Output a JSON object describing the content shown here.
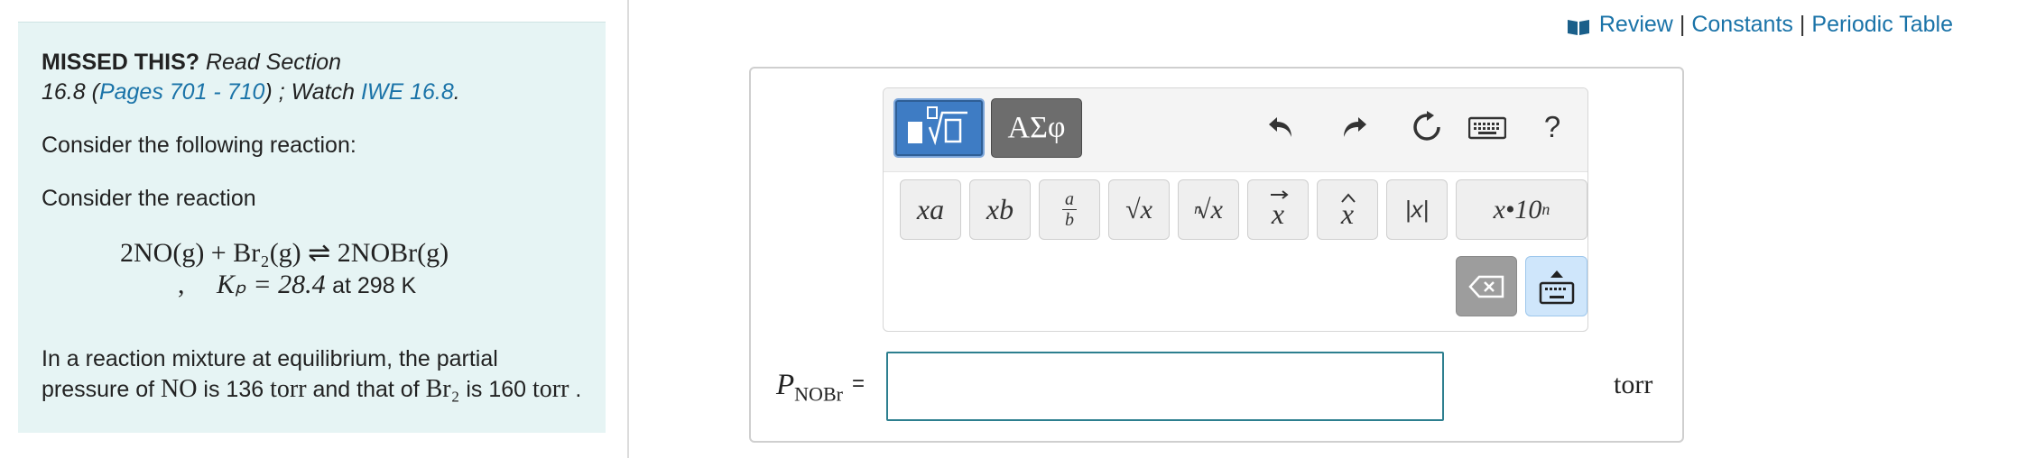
{
  "left_panel": {
    "missed_bold": "MISSED THIS?",
    "read_section": "Read Section",
    "section_num": "16.8 (",
    "pages_link": "Pages 701 - 710",
    "watch_prefix": ") ; Watch",
    "iwe_link": "IWE 16.8",
    "period": ".",
    "consider_following": "Consider the following reaction:",
    "consider_reaction": "Consider the reaction",
    "equation": "2NO(g) + Br₂(g) ⇌ 2NOBr(g)",
    "comma": ",",
    "kp_expr": "Kₚ = 28.4",
    "kp_at": "at 298 K",
    "mixture_part1": "In a reaction mixture at equilibrium, the partial pressure of",
    "no_species": "NO",
    "mixture_part2": "is 136",
    "torr1": "torr",
    "mixture_part3": "and that of",
    "br2_species": "Br₂",
    "mixture_part4": "is 160",
    "torr2": "torr",
    "mixture_end": "."
  },
  "nav": {
    "review": "Review",
    "separator": "|",
    "constants": "Constants",
    "periodic_table": "Periodic Table"
  },
  "toolbar": {
    "greek_label": "ΑΣφ",
    "help_label": "?",
    "keys": {
      "superscript_base": "x",
      "superscript_exp": "a",
      "subscript_base": "x",
      "subscript_sub": "b",
      "fraction_num": "a",
      "fraction_den": "b",
      "sqrt_label": "√x",
      "nthroot_index": "n",
      "nthroot_label": "√x",
      "vector_label": "x",
      "hat_label": "x",
      "abs_label": "|x|",
      "sci_label": "x•10",
      "sci_exp": "n"
    }
  },
  "answer": {
    "label_var": "P",
    "label_sub": "NOBr",
    "label_eq": "=",
    "value": "",
    "unit": "torr"
  },
  "colors": {
    "link": "#1a73a8",
    "panel_bg": "#e6f4f4",
    "input_border": "#2d7f8f"
  }
}
